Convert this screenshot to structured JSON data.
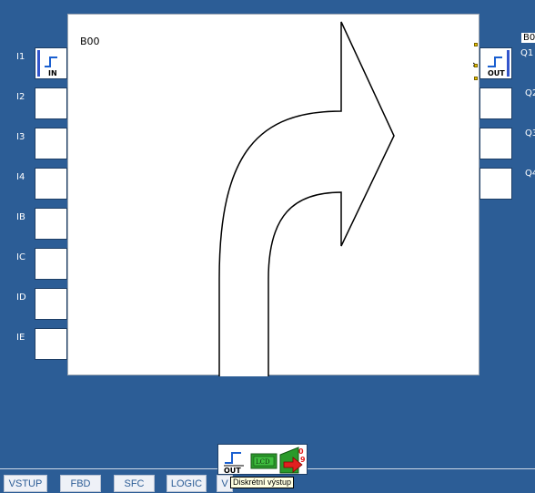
{
  "inputs": {
    "pins": [
      "I1",
      "I2",
      "I3",
      "I4",
      "IB",
      "IC",
      "ID",
      "IE"
    ],
    "in_block_label": "IN"
  },
  "workarea": {
    "block_title": "B00"
  },
  "outputs": {
    "pins": [
      "Q1",
      "Q2",
      "Q3",
      "Q4"
    ],
    "selected_block_label": "B0",
    "out_block_label": "OUT"
  },
  "palette": {
    "items": [
      {
        "label": "OUT",
        "icon": "digital-output-icon"
      },
      {
        "label": "LCD",
        "icon": "lcd-icon"
      },
      {
        "label": "",
        "icon": "analog-output-icon"
      }
    ],
    "tooltip": "Diskrétní výstup"
  },
  "tabs": [
    "VSTUP",
    "FBD",
    "SFC",
    "LOGIC",
    "V"
  ],
  "colors": {
    "background": "#2c5d96",
    "panel": "#ffffff",
    "selection": "#e8c200",
    "lcd_green": "#2a9a2a"
  }
}
